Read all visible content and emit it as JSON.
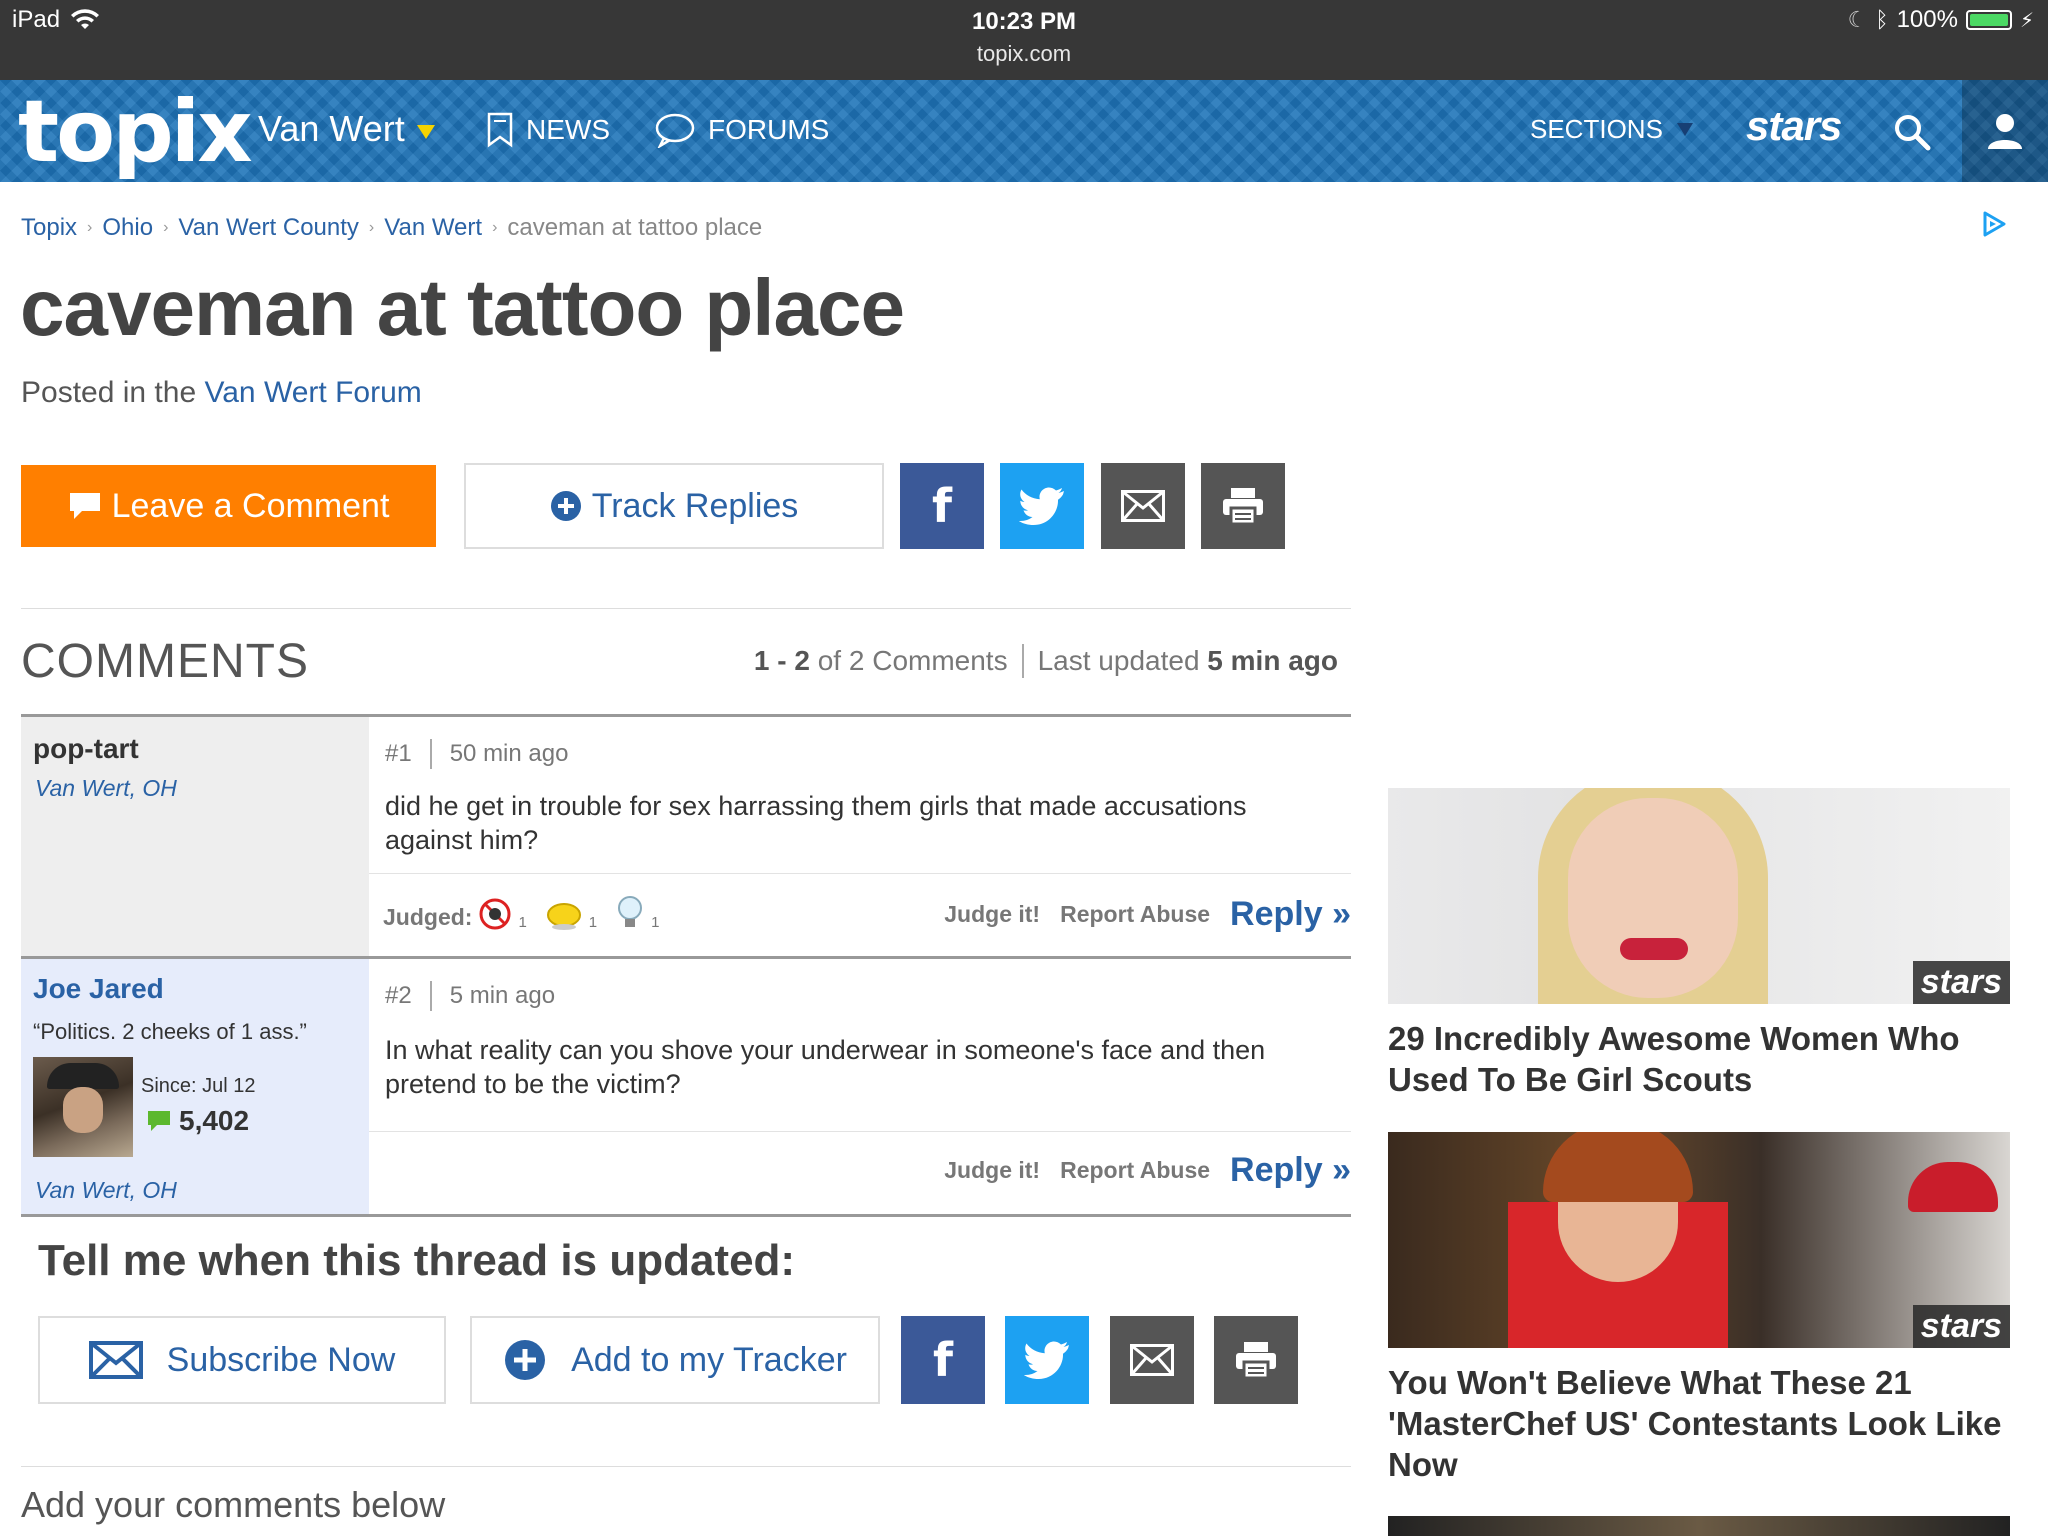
{
  "status": {
    "device": "iPad",
    "time": "10:23 PM",
    "url": "topix.com",
    "battery": "100%",
    "battery_level": 1.0
  },
  "nav": {
    "logo": "topix",
    "location": "Van Wert",
    "news": "NEWS",
    "forums": "FORUMS",
    "sections": "SECTIONS",
    "stars": "stars"
  },
  "breadcrumb": [
    "Topix",
    "Ohio",
    "Van Wert County",
    "Van Wert",
    "caveman at tattoo place"
  ],
  "title": "caveman at tattoo place",
  "posted": {
    "prefix": "Posted in the",
    "forum": "Van Wert Forum"
  },
  "actions": {
    "leave_comment": "Leave a Comment",
    "track_replies": "Track Replies"
  },
  "comments_header": {
    "title": "COMMENTS",
    "range": "1 - 2",
    "of_total": "of 2 Comments",
    "updated_label": "Last updated",
    "updated_value": "5 min ago"
  },
  "comments": [
    {
      "user": "pop-tart",
      "location": "Van Wert, OH",
      "number": "#1",
      "time": "50 min ago",
      "text": "did he get in trouble for sex harrassing them girls that made accusations against him?",
      "judged_label": "Judged:",
      "judged_counts": [
        "1",
        "1",
        "1"
      ],
      "judge": "Judge it!",
      "report": "Report Abuse",
      "reply": "Reply »"
    },
    {
      "user": "Joe Jared",
      "quote": "“Politics. 2 cheeks of 1 ass.”",
      "since": "Since: Jul 12",
      "posts": "5,402",
      "location": "Van Wert, OH",
      "number": "#2",
      "time": "5 min ago",
      "text": "In what reality can you shove your underwear in someone's face and then pretend to be the victim?",
      "judge": "Judge it!",
      "report": "Report Abuse",
      "reply": "Reply »"
    }
  ],
  "notify": {
    "title": "Tell me when this thread is updated:",
    "subscribe": "Subscribe Now",
    "tracker": "Add to my Tracker"
  },
  "add_below": "Add your comments below",
  "sidebar": [
    {
      "caption": "29 Incredibly Awesome Women Who Used To Be Girl Scouts",
      "badge": "stars"
    },
    {
      "caption": "You Won't Believe What These 21 'MasterChef US' Contestants Look Like Now",
      "badge": "stars"
    }
  ],
  "colors": {
    "nav_blue": "#1d73b8",
    "orange": "#ff7f00",
    "link_blue": "#2a62a5",
    "facebook": "#3b5998",
    "twitter": "#1da1f2"
  }
}
